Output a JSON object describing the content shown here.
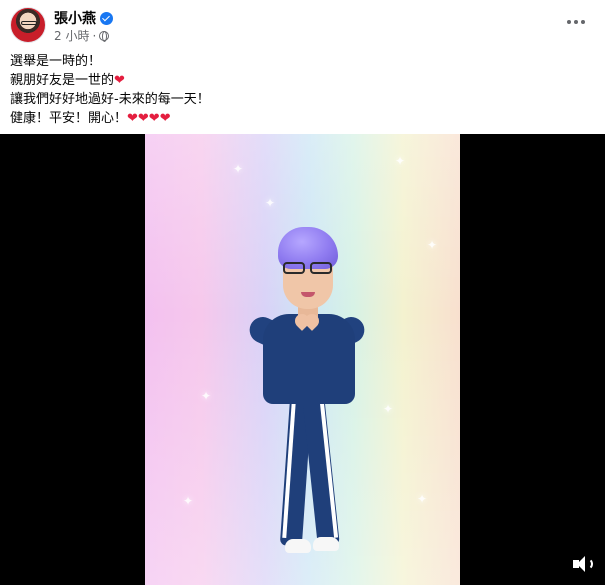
{
  "post": {
    "author": "張小燕",
    "timestamp": "2 小時",
    "separator": "·",
    "text_lines": [
      "選舉是一時的！",
      "親朋好友是一世的",
      "讓我們好好地過好-未來的每一天！",
      "健康！平安！開心！"
    ],
    "hearts_line2": "❤",
    "hearts_line4": "❤❤❤❤"
  },
  "icons": {
    "verified": "verified-badge-icon",
    "audience": "globe-icon",
    "more": "more-options-icon",
    "mute": "volume-icon"
  },
  "colors": {
    "accent": "#1877f2",
    "heart": "#e41e3f",
    "meta_text": "#65676b",
    "video_bg": "#000000"
  }
}
